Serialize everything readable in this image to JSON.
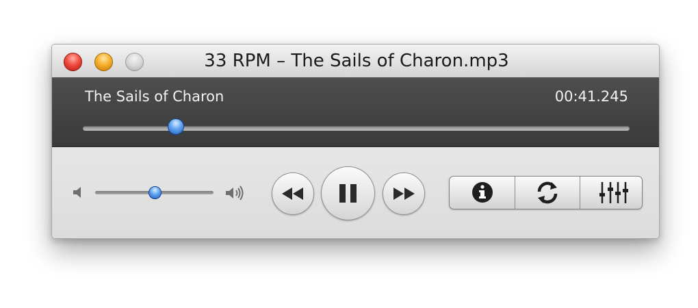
{
  "window": {
    "title": "33 RPM – The Sails of Charon.mp3",
    "traffic_lights": [
      "close",
      "minimize",
      "zoom"
    ]
  },
  "now_playing": {
    "track_name": "The Sails of Charon",
    "elapsed_time": "00:41.245",
    "playback_position_fraction": 0.17
  },
  "volume": {
    "level_fraction": 0.5,
    "low_icon": "speaker-low-icon",
    "high_icon": "speaker-high-icon"
  },
  "transport": {
    "buttons": [
      "rewind-icon",
      "pause-icon",
      "fast-forward-icon"
    ]
  },
  "tools": {
    "buttons": [
      "info-icon",
      "repeat-icon",
      "equalizer-icon"
    ]
  },
  "colors": {
    "panel_dark": "#444444",
    "knob_blue": "#3b82e0",
    "close_red": "#e8443a",
    "minimize_amber": "#f2a428",
    "zoom_gray": "#c8c8c8"
  }
}
